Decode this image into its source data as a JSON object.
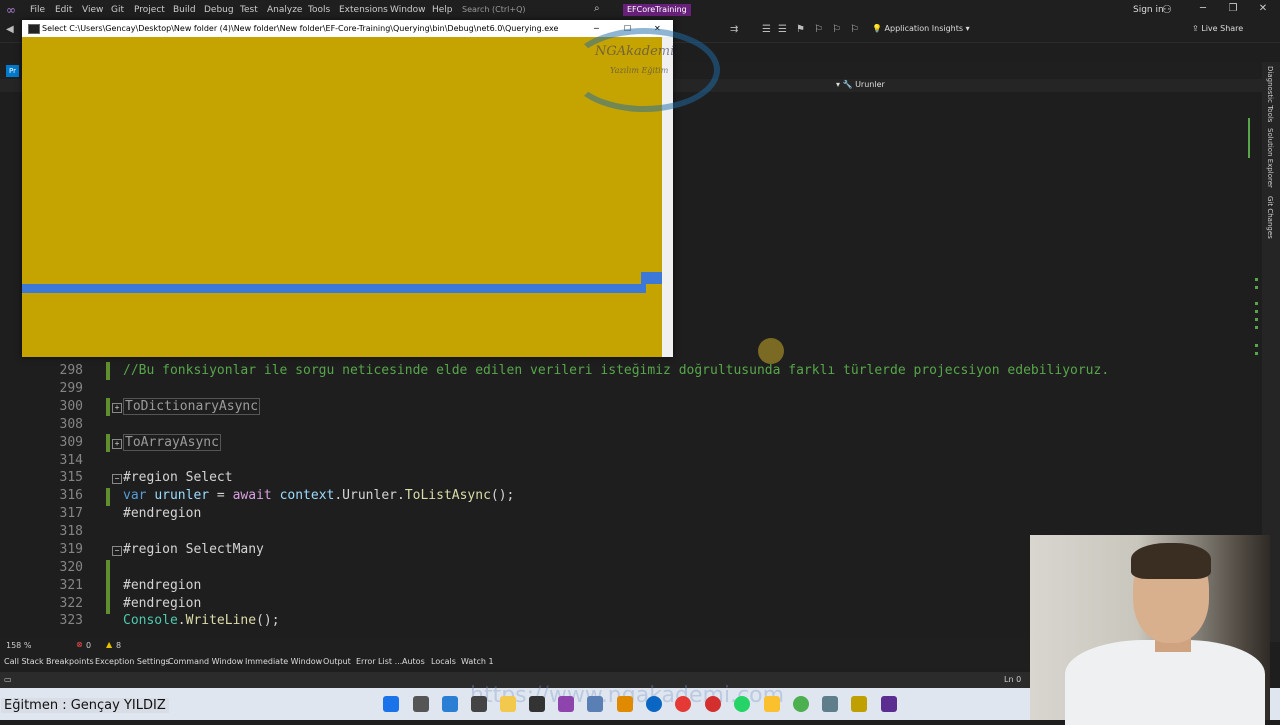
{
  "menu": {
    "items": [
      "File",
      "Edit",
      "View",
      "Git",
      "Project",
      "Build",
      "Debug",
      "Test",
      "Analyze",
      "Tools",
      "Extensions",
      "Window",
      "Help"
    ],
    "search_placeholder": "Search (Ctrl+Q)",
    "solution_name": "EFCoreTraining",
    "sign_in": "Sign in"
  },
  "toolbar": {
    "app_insights": "Application Insights",
    "live_share": "Live Share"
  },
  "tabs": {
    "preview_tab": "Pr"
  },
  "navbar": {
    "member": "Urunler"
  },
  "right_rail": [
    "Diagnostic Tools",
    "Solution Explorer",
    "Git Changes"
  ],
  "console": {
    "title": "Select C:\\Users\\Gencay\\Desktop\\New folder (4)\\New folder\\New folder\\EF-Core-Training\\Querying\\bin\\Debug\\net6.0\\Querying.exe"
  },
  "watermark": {
    "text": "NGAkademi",
    "sub": "Yazılım Eğitim"
  },
  "code": [
    {
      "line": "298",
      "parts": [
        {
          "t": "//Bu fonksiyonlar ile sorgu neticesinde elde edilen verileri isteğimiz doğrultusunda farklı türlerde projecsiyon edebiliyoruz.",
          "c": "cmt"
        }
      ]
    },
    {
      "line": "299",
      "parts": []
    },
    {
      "line": "300",
      "fold": "+",
      "parts": [
        {
          "t": "ToDictionaryAsync",
          "c": "collapsed"
        }
      ]
    },
    {
      "line": "308",
      "parts": []
    },
    {
      "line": "309",
      "fold": "+",
      "parts": [
        {
          "t": "ToArrayAsync",
          "c": "collapsed"
        }
      ]
    },
    {
      "line": "314",
      "parts": []
    },
    {
      "line": "315",
      "fold": "-",
      "parts": [
        {
          "t": "#region Select",
          "c": "plain"
        }
      ]
    },
    {
      "line": "316",
      "parts": [
        {
          "t": "var ",
          "c": "kw"
        },
        {
          "t": "urunler",
          "c": "var"
        },
        {
          "t": " = ",
          "c": "plain"
        },
        {
          "t": "await ",
          "c": "ctl"
        },
        {
          "t": "context",
          "c": "var"
        },
        {
          "t": ".Urunler.",
          "c": "plain"
        },
        {
          "t": "ToListAsync",
          "c": "mth"
        },
        {
          "t": "();",
          "c": "plain"
        }
      ]
    },
    {
      "line": "317",
      "parts": [
        {
          "t": "#endregion",
          "c": "plain"
        }
      ]
    },
    {
      "line": "318",
      "parts": []
    },
    {
      "line": "319",
      "fold": "-",
      "parts": [
        {
          "t": "#region SelectMany",
          "c": "plain"
        }
      ]
    },
    {
      "line": "320",
      "parts": []
    },
    {
      "line": "321",
      "parts": [
        {
          "t": "#endregion",
          "c": "plain"
        }
      ]
    },
    {
      "line": "322",
      "parts": [
        {
          "t": "#endregion",
          "c": "plain"
        }
      ]
    },
    {
      "line": "323",
      "parts": [
        {
          "t": "Console",
          "c": "cls"
        },
        {
          "t": ".",
          "c": "plain"
        },
        {
          "t": "WriteLine",
          "c": "mth"
        },
        {
          "t": "();",
          "c": "plain"
        }
      ]
    }
  ],
  "status": {
    "zoom": "158 %",
    "errors": "0",
    "warnings": "8",
    "line_info": "Ln 0"
  },
  "tool_tabs": [
    "Call Stack",
    "Breakpoints",
    "Exception Settings",
    "Command Window",
    "Immediate Window",
    "Output",
    "Error List ...",
    "Autos",
    "Locals",
    "Watch 1"
  ],
  "taskbar": {
    "instructor": "Eğitmen : Gençay YILDIZ",
    "url": "https://www.ngakademi.com"
  },
  "colors": {
    "console_bg": "#c5a300",
    "console_bar": "#3c78d8",
    "accent": "#68217a"
  }
}
